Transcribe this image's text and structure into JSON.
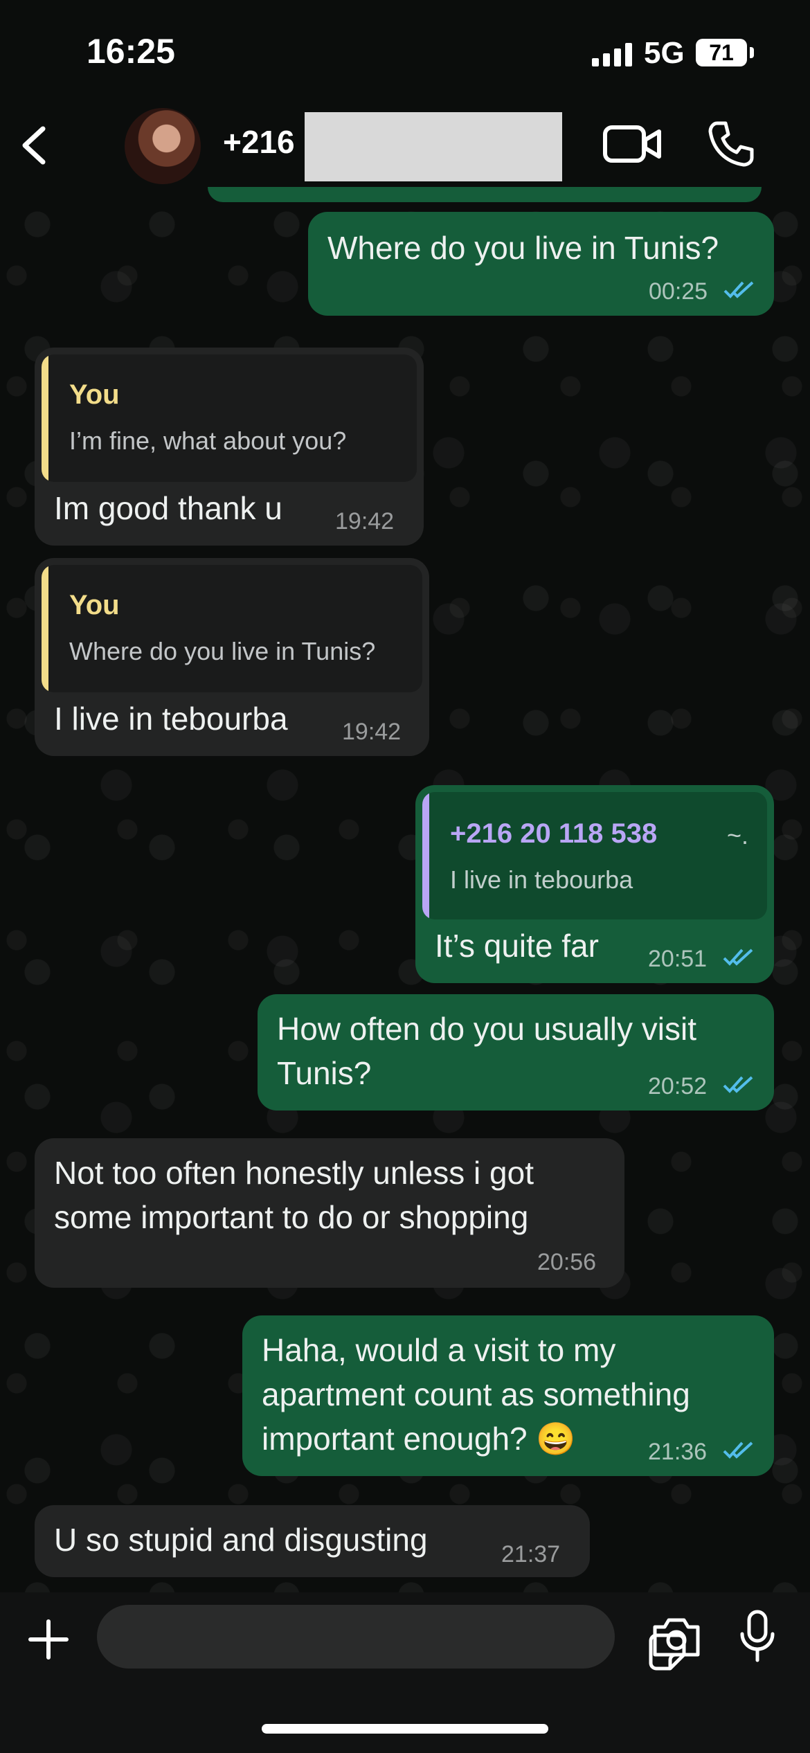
{
  "status_bar": {
    "time": "16:25",
    "network": "5G",
    "battery": "71"
  },
  "header": {
    "contact_name": "+216",
    "back_icon": "chevron-left-icon",
    "video_icon": "video-camera-icon",
    "call_icon": "phone-icon"
  },
  "messages": [
    {
      "direction": "out",
      "text": "Where do you live in Tunis?",
      "time": "00:25",
      "read": true
    },
    {
      "direction": "in",
      "quote_author": "You",
      "quote_text": "I’m fine, what about you?",
      "text": "Im good thank u",
      "time": "19:42"
    },
    {
      "direction": "in",
      "quote_author": "You",
      "quote_text": "Where do you live in Tunis?",
      "text": "I live in tebourba",
      "time": "19:42"
    },
    {
      "direction": "out",
      "quote_author": "+216 20 118 538",
      "quote_suffix": "~.",
      "quote_text": "I live in tebourba",
      "text": "It’s quite far",
      "time": "20:51",
      "read": true
    },
    {
      "direction": "out",
      "text_line1": "How often do you usually visit",
      "text_line2": "Tunis?",
      "time": "20:52",
      "read": true
    },
    {
      "direction": "in",
      "text_line1": "Not too often honestly unless i got",
      "text_line2": "some important to do or shopping",
      "time": "20:56"
    },
    {
      "direction": "out",
      "text_line1": "Haha, would a visit to my",
      "text_line2": "apartment count as something",
      "text_line3": "important enough? 😄",
      "time": "21:36",
      "read": true
    },
    {
      "direction": "in",
      "text": "U so stupid and disgusting",
      "time": "21:37"
    }
  ],
  "input_bar": {
    "plus_icon": "plus-icon",
    "sticker_icon": "sticker-icon",
    "camera_icon": "camera-icon",
    "mic_icon": "microphone-icon"
  },
  "colors": {
    "outgoing_bubble": "#155d3a",
    "incoming_bubble": "#232424",
    "quote_you": "#f3dd8a",
    "quote_other": "#b9a6f5",
    "read_ticks": "#53bdeb"
  }
}
